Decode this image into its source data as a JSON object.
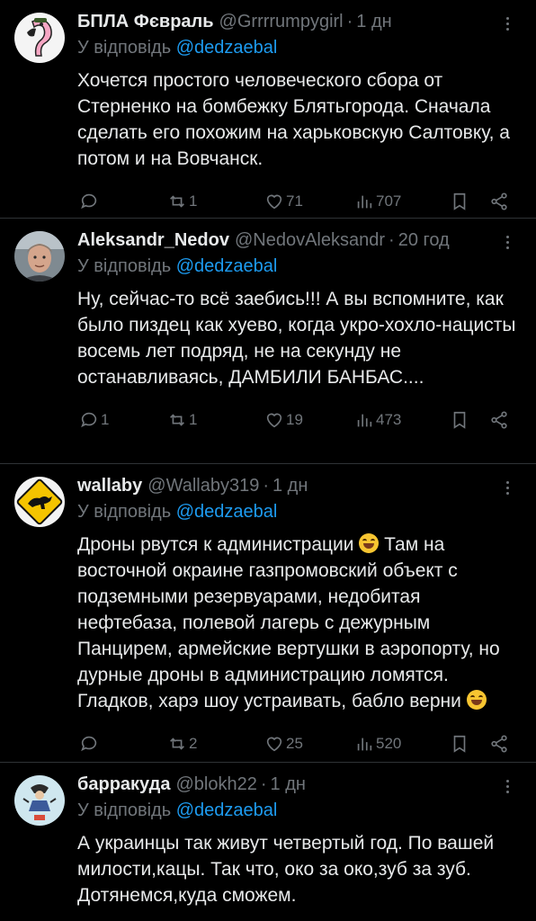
{
  "tweets": [
    {
      "name": "БПЛА Фєвраль",
      "handle": "@Grrrrumpygirl",
      "time": "1 дн",
      "reply_prefix": "У відповідь",
      "mention": "@dedzaebal",
      "text": "Хочется простого человеческого сбора от Стерненко на бомбежку Блятьгорода. Сначала сделать его похожим на харьковскую Салтовку, а потом и на Вовчанск.",
      "replies": "",
      "reposts": "1",
      "likes": "71",
      "views": "707",
      "avatar": "flamingo-avatar"
    },
    {
      "name": "Aleksandr_Nedov",
      "handle": "@NedovAleksandr",
      "time": "20 год",
      "reply_prefix": "У відповідь",
      "mention": "@dedzaebal",
      "text": "Ну, сейчас-то всё заебись!!! А вы вспомните, как было пиздец как хуево, когда укро-хохло-нацисты восемь лет подряд, не на секунду не останавливаясь, ДАМБИЛИ БАНБАС....",
      "replies": "1",
      "reposts": "1",
      "likes": "19",
      "views": "473",
      "avatar": "man-photo-avatar"
    },
    {
      "name": "wallaby",
      "handle": "@Wallaby319",
      "time": "1 дн",
      "reply_prefix": "У відповідь",
      "mention": "@dedzaebal",
      "text_a": "Дроны рвутся к администрации ",
      "text_b": " Там на восточной окраине газпромовский объект с подземными резервуарами, недобитая нефтебаза, полевой лагерь с дежурным Панцирем, армейские вертушки в аэропорту, но дурные дроны в администрацию ломятся. Гладков, харэ шоу устраивать, бабло верни ",
      "replies": "",
      "reposts": "2",
      "likes": "25",
      "views": "520",
      "avatar": "kangaroo-sign-avatar"
    },
    {
      "name": "барракуда",
      "handle": "@blokh22",
      "time": "1 дн",
      "reply_prefix": "У відповідь",
      "mention": "@dedzaebal",
      "text": "А украинцы так живут четвертый год. По вашей милости,кацы. Так что, око за око,зуб за зуб. Дотянемся,куда сможем.",
      "avatar": "illustration-avatar"
    }
  ],
  "colors": {
    "background": "#000000",
    "text": "#e7e9ea",
    "secondary": "#71767b",
    "accent": "#1d9bf0",
    "divider": "#2f3336"
  }
}
